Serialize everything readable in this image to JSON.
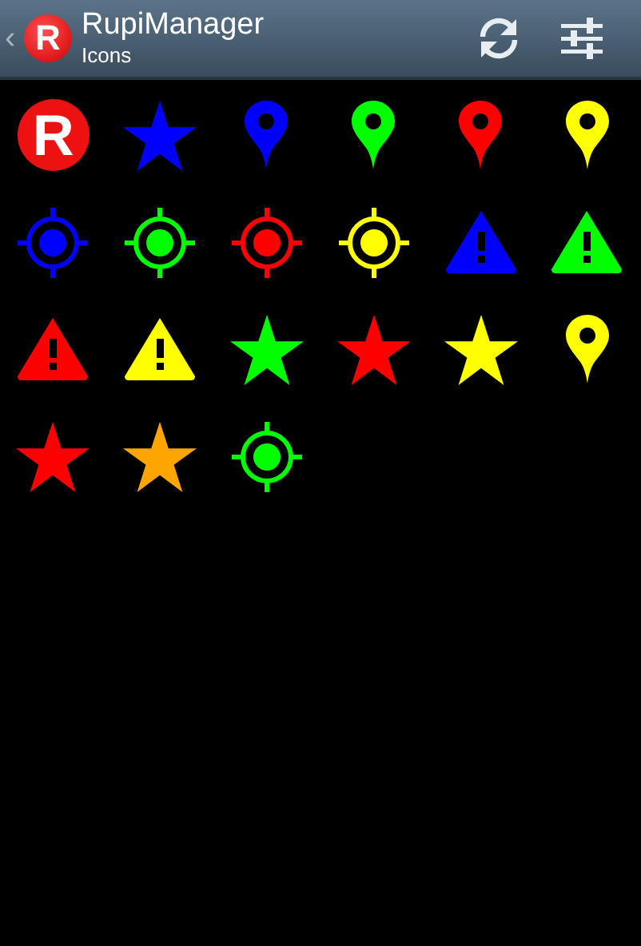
{
  "action_bar": {
    "back": "‹",
    "logo_letter": "R",
    "title": "RupiManager",
    "subtitle": "Icons"
  },
  "icons": [
    {
      "kind": "logo",
      "letter": "R",
      "color": "#ee1111"
    },
    {
      "kind": "star",
      "color": "#0000ff"
    },
    {
      "kind": "pin",
      "color": "#0000ff"
    },
    {
      "kind": "pin",
      "color": "#00ff00"
    },
    {
      "kind": "pin",
      "color": "#ff0000"
    },
    {
      "kind": "pin",
      "color": "#ffff00"
    },
    {
      "kind": "target",
      "color": "#0000ff"
    },
    {
      "kind": "target",
      "color": "#00ff00"
    },
    {
      "kind": "target",
      "color": "#ff0000"
    },
    {
      "kind": "target",
      "color": "#ffff00"
    },
    {
      "kind": "warning",
      "color": "#0000ff"
    },
    {
      "kind": "warning",
      "color": "#00ff00"
    },
    {
      "kind": "warning",
      "color": "#ff0000"
    },
    {
      "kind": "warning",
      "color": "#ffff00"
    },
    {
      "kind": "star",
      "color": "#00ff00"
    },
    {
      "kind": "star",
      "color": "#ff0000"
    },
    {
      "kind": "star",
      "color": "#ffff00"
    },
    {
      "kind": "pin",
      "color": "#ffff00"
    },
    {
      "kind": "star",
      "color": "#ff0000"
    },
    {
      "kind": "star",
      "color": "#ffa500"
    },
    {
      "kind": "target",
      "color": "#00ff00"
    }
  ]
}
